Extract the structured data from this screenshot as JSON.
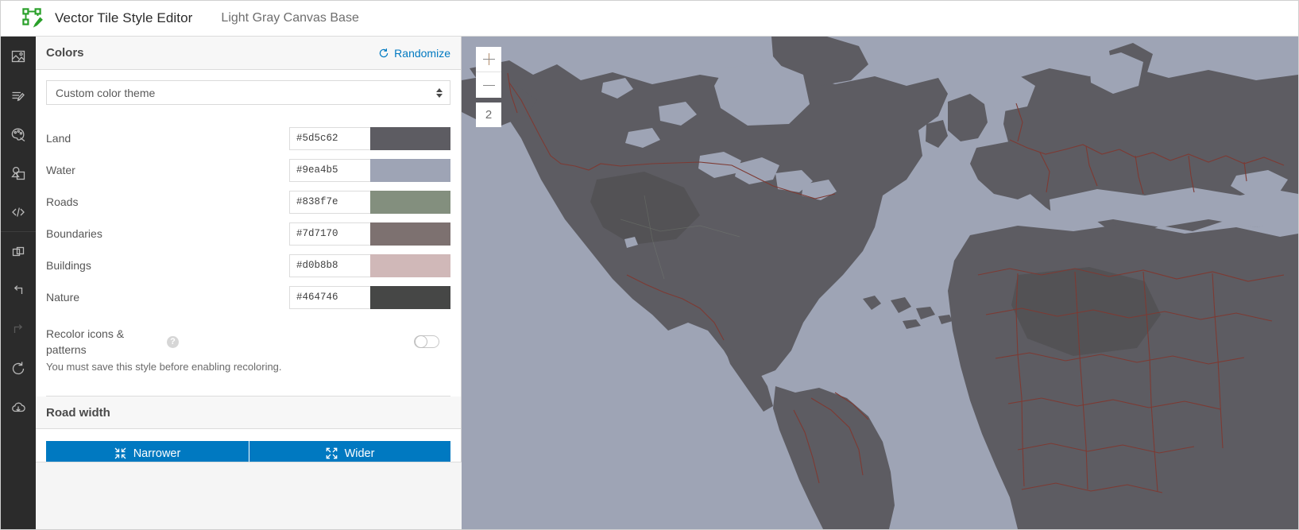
{
  "header": {
    "logo_icon": "vector-tile-editor-logo",
    "app_title": "Vector Tile Style Editor",
    "style_name": "Light Gray Canvas Base"
  },
  "rail": {
    "items": [
      {
        "icon": "map-image-icon",
        "label": "Map"
      },
      {
        "icon": "edit-layers-icon",
        "label": "Edit layers"
      },
      {
        "icon": "palette-icon",
        "label": "Colors"
      },
      {
        "icon": "sprites-icon",
        "label": "Sprites"
      },
      {
        "icon": "code-icon",
        "label": "Code"
      },
      {
        "icon": "duplicate-icon",
        "label": "Duplicate"
      },
      {
        "icon": "undo-icon",
        "label": "Undo"
      },
      {
        "icon": "redo-icon",
        "label": "Redo"
      },
      {
        "icon": "reset-icon",
        "label": "Reset"
      },
      {
        "icon": "save-cloud-icon",
        "label": "Save"
      }
    ]
  },
  "colors_panel": {
    "title": "Colors",
    "randomize_label": "Randomize",
    "randomize_icon": "refresh-icon",
    "theme_select": {
      "value": "Custom color theme",
      "options": [
        "Custom color theme"
      ],
      "arrow_icon": "chevron-updown-icon"
    },
    "swatches": [
      {
        "label": "Land",
        "hex": "#5d5c62"
      },
      {
        "label": "Water",
        "hex": "#9ea4b5"
      },
      {
        "label": "Roads",
        "hex": "#838f7e"
      },
      {
        "label": "Boundaries",
        "hex": "#7d7170"
      },
      {
        "label": "Buildings",
        "hex": "#d0b8b8"
      },
      {
        "label": "Nature",
        "hex": "#464746"
      }
    ],
    "recolor": {
      "label_line1": "Recolor icons &",
      "label_line2": "patterns",
      "help_icon": "question-icon",
      "help_glyph": "?",
      "toggle_state": "off",
      "note": "You must save this style before enabling recoloring."
    }
  },
  "road_width_panel": {
    "title": "Road width",
    "narrower_label": "Narrower",
    "narrower_icon": "contract-arrows-icon",
    "wider_label": "Wider",
    "wider_icon": "expand-arrows-icon"
  },
  "map": {
    "zoom_in_label": "+",
    "zoom_in_icon": "plus-icon",
    "zoom_out_label": "−",
    "zoom_out_icon": "minus-icon",
    "zoom_level": "2",
    "land_color": "#5d5c62",
    "water_color": "#9ea4b5",
    "boundary_color": "#7d3a33",
    "nature_color": "#464746"
  },
  "theme": {
    "accent_blue": "#0079c1",
    "rail_bg": "#2b2b2b",
    "panel_header_bg": "#f7f7f7"
  }
}
